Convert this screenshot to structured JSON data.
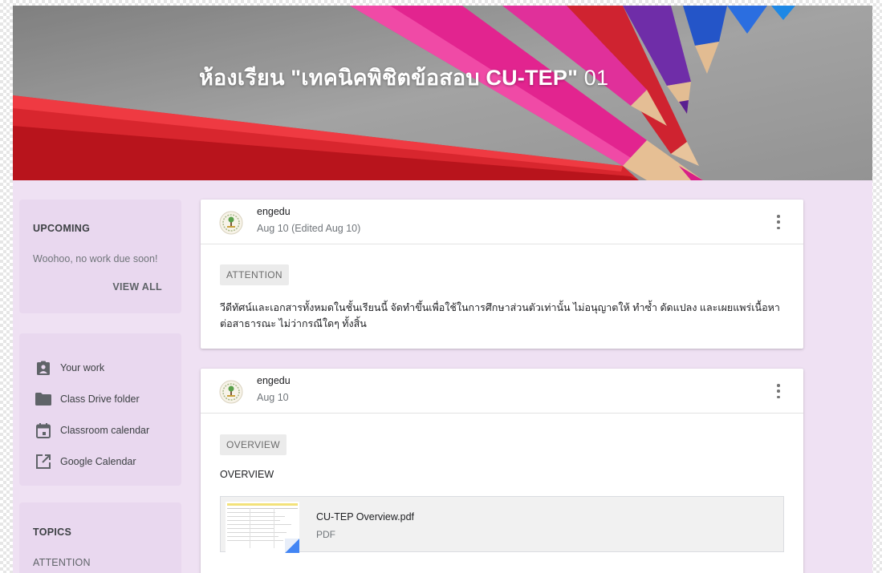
{
  "banner": {
    "title": "ห้องเรียน \"เทคนิคพิชิตข้อสอบ CU-TEP\"",
    "title_number": "01"
  },
  "upcoming": {
    "heading": "UPCOMING",
    "message": "Woohoo, no work due soon!",
    "view_all": "VIEW ALL"
  },
  "links": [
    {
      "label": "Your work",
      "icon": "assignment-ind-icon"
    },
    {
      "label": "Class Drive folder",
      "icon": "folder-icon"
    },
    {
      "label": "Classroom calendar",
      "icon": "calendar-icon"
    },
    {
      "label": "Google Calendar",
      "icon": "open-in-new-icon"
    }
  ],
  "topics": {
    "heading": "TOPICS",
    "items": [
      "ATTENTION"
    ]
  },
  "posts": [
    {
      "author": "engedu",
      "date": "Aug 10 (Edited Aug 10)",
      "topic": "ATTENTION",
      "body": "วีดีทัศน์และเอกสารทั้งหมดในชั้นเรียนนี้ จัดทำขึ้นเพื่อใช้ในการศึกษาส่วนตัวเท่านั้น ไม่อนุญาตให้ ทำซ้ำ ดัดแปลง และเผยแพร่เนื้อหา ต่อสาธารณะ ไม่ว่ากรณีใดๆ ทั้งสิ้น"
    },
    {
      "author": "engedu",
      "date": "Aug 10",
      "topic": "OVERVIEW",
      "text": "OVERVIEW",
      "attachment": {
        "name": "CU-TEP Overview.pdf",
        "type": "PDF"
      }
    }
  ],
  "colors": {
    "page_bg": "#efe1f3",
    "sidebar_card": "#e9d8ef",
    "drive_badge": "#4285f4"
  }
}
